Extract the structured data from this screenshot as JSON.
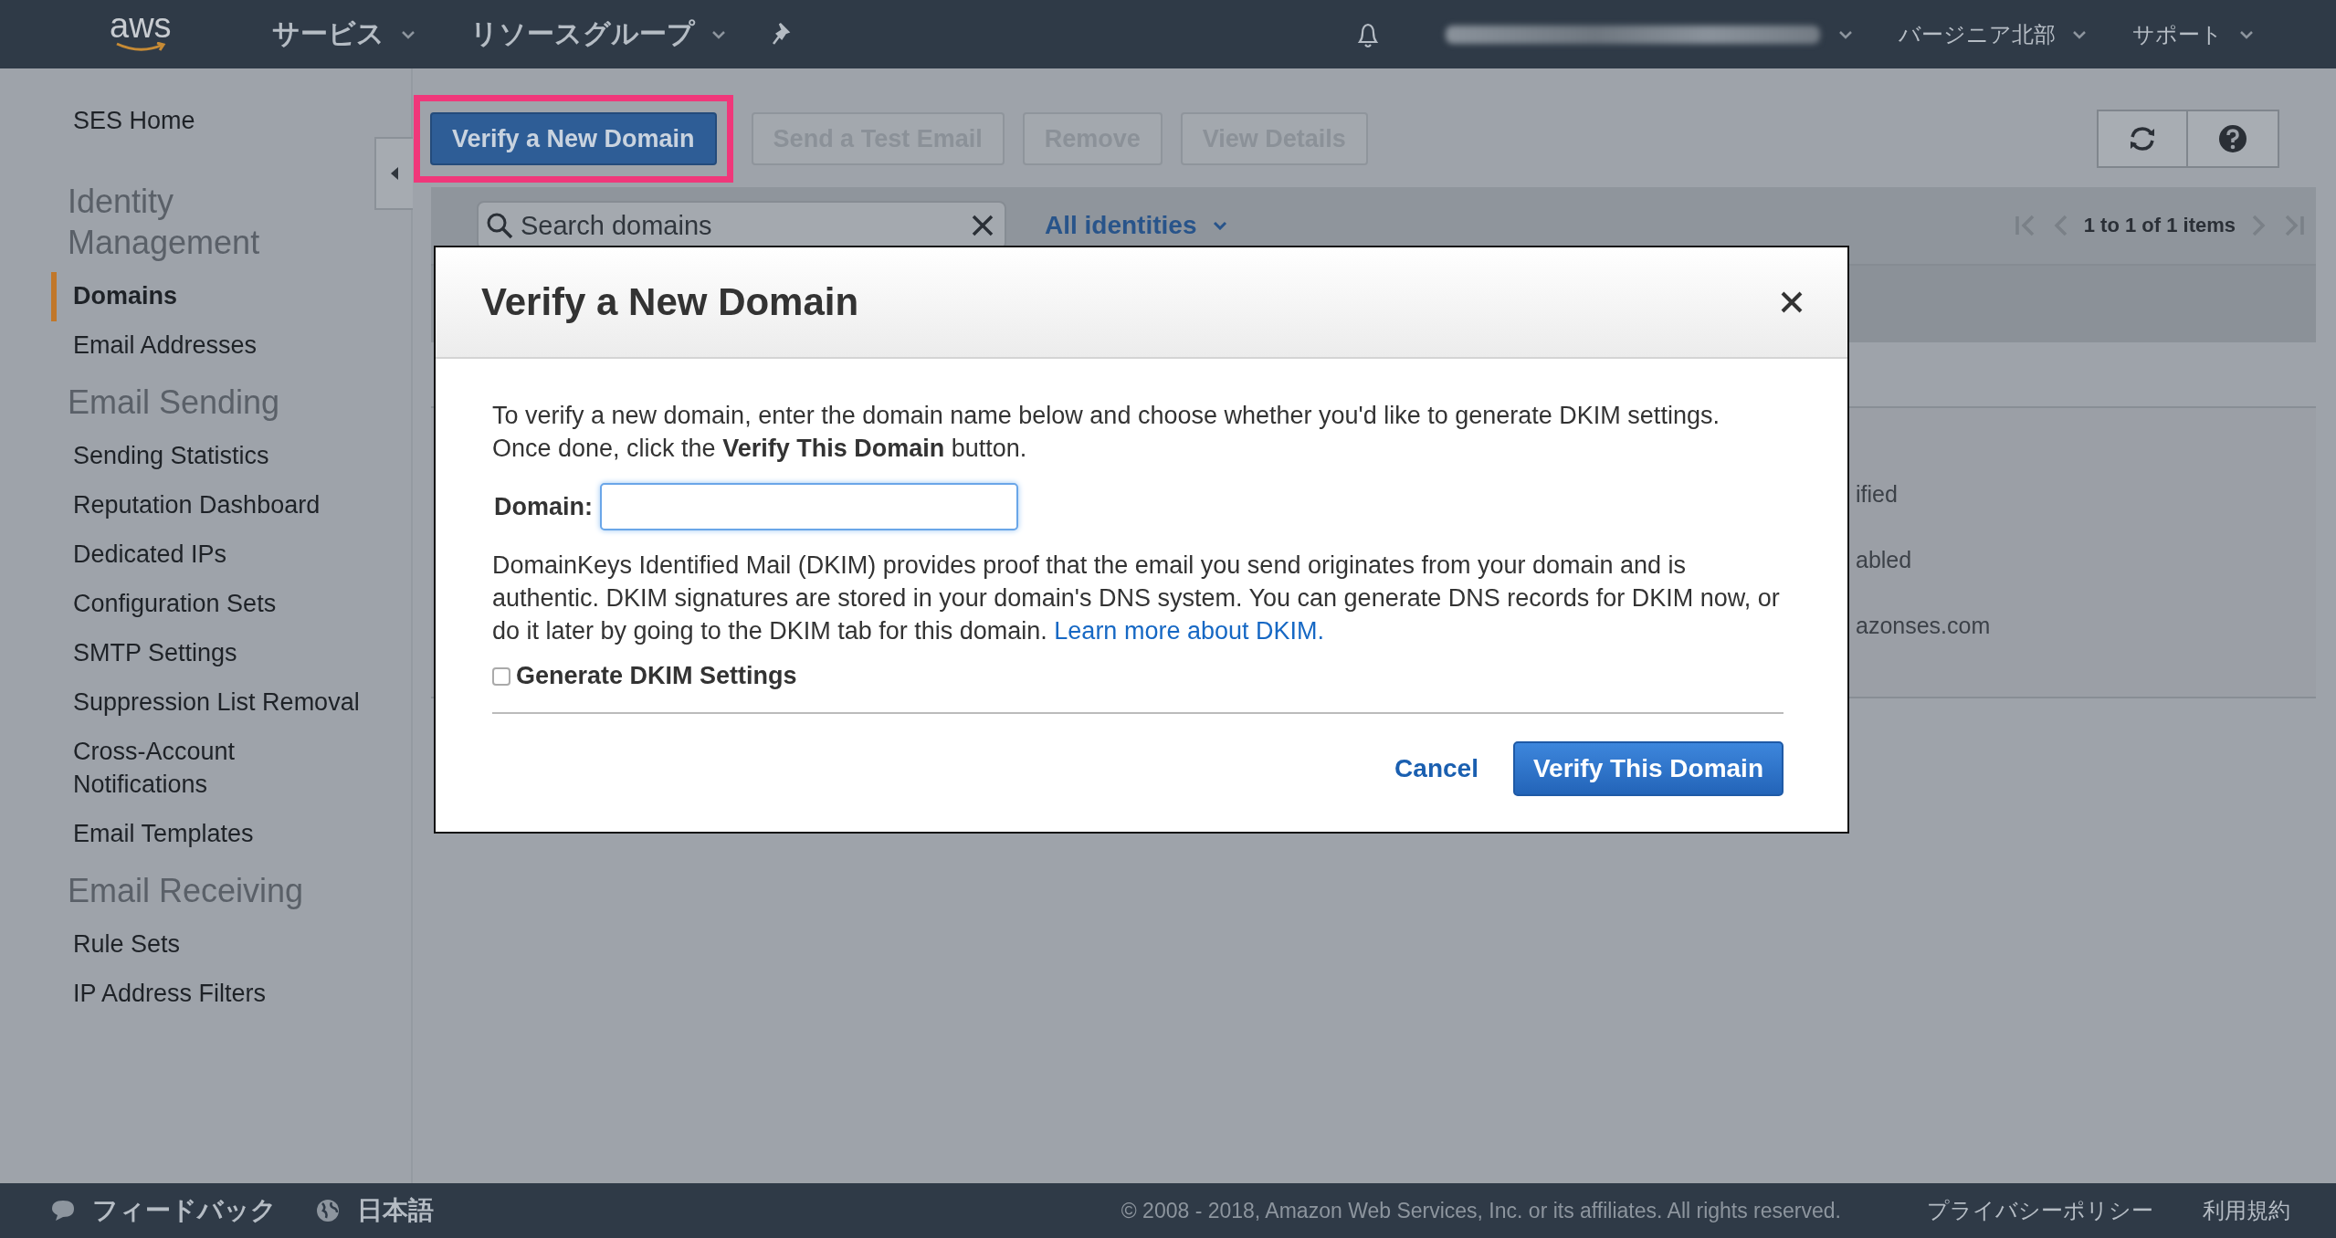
{
  "top_nav": {
    "logo": "aws",
    "menus": [
      {
        "label": "サービス"
      },
      {
        "label": "リソースグループ"
      }
    ],
    "right_menus": [
      {
        "label": "バージニア北部"
      },
      {
        "label": "サポート"
      }
    ]
  },
  "sidebar": {
    "home": "SES Home",
    "sections": [
      {
        "title": "Identity Management",
        "items": [
          {
            "label": "Domains",
            "selected": true
          },
          {
            "label": "Email Addresses",
            "selected": false
          }
        ]
      },
      {
        "title": "Email Sending",
        "items": [
          {
            "label": "Sending Statistics",
            "selected": false
          },
          {
            "label": "Reputation Dashboard",
            "selected": false
          },
          {
            "label": "Dedicated IPs",
            "selected": false
          },
          {
            "label": "Configuration Sets",
            "selected": false
          },
          {
            "label": "SMTP Settings",
            "selected": false
          },
          {
            "label": "Suppression List Removal",
            "selected": false
          },
          {
            "label": "Cross-Account Notifications",
            "selected": false
          },
          {
            "label": "Email Templates",
            "selected": false
          }
        ]
      },
      {
        "title": "Email Receiving",
        "items": [
          {
            "label": "Rule Sets",
            "selected": false
          },
          {
            "label": "IP Address Filters",
            "selected": false
          }
        ]
      }
    ]
  },
  "toolbar": {
    "buttons": [
      {
        "label": "Verify a New Domain",
        "kind": "primary",
        "disabled": false,
        "highlighted": true
      },
      {
        "label": "Send a Test Email",
        "kind": "secondary",
        "disabled": true,
        "highlighted": false
      },
      {
        "label": "Remove",
        "kind": "secondary",
        "disabled": true,
        "highlighted": false
      },
      {
        "label": "View Details",
        "kind": "secondary",
        "disabled": true,
        "highlighted": false
      }
    ]
  },
  "filter_bar": {
    "search": {
      "placeholder": "Search domains"
    },
    "filter": "All identities",
    "pagination": "1 to 1 of 1 items"
  },
  "table": {
    "rows": [
      "ified",
      "abled",
      "azonses.com"
    ]
  },
  "dialog": {
    "title": "Verify a New Domain",
    "intro": "To verify a new domain, enter the domain name below and choose whether you'd like to generate DKIM settings. Once done, click the **Verify This Domain** button.",
    "domain_label": "Domain:",
    "dkim_text": "DomainKeys Identified Mail (DKIM) provides proof that the email you send originates from your domain and is authentic. DKIM signatures are stored in your domain's DNS system. You can generate DNS records for DKIM now, or do it later by going to the DKIM tab for this domain.",
    "dkim_link": "Learn more about DKIM.",
    "checkbox": {
      "label": "Generate DKIM Settings",
      "checked": false
    },
    "cancel": "Cancel",
    "submit": "Verify This Domain"
  },
  "footer": {
    "feedback": "フィードバック",
    "language": "日本語",
    "copyright": "© 2008 - 2018, Amazon Web Services, Inc. or its affiliates. All rights reserved.",
    "links": [
      "プライバシーポリシー",
      "利用規約"
    ]
  }
}
